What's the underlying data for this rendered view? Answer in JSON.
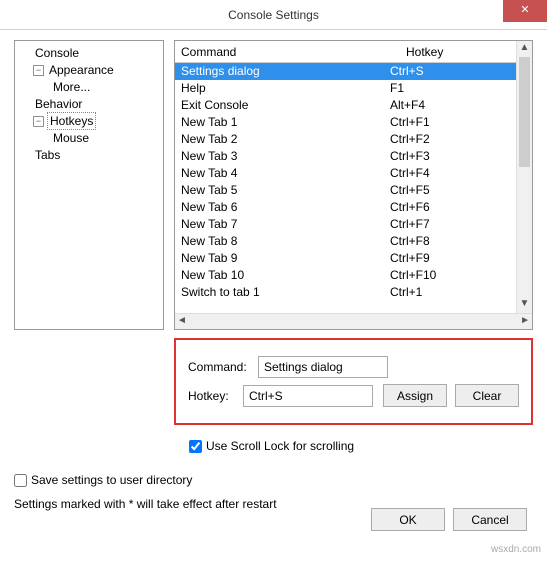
{
  "title": "Console Settings",
  "tree": {
    "items": [
      {
        "label": "Console",
        "level": 1
      },
      {
        "label": "Appearance",
        "level": 1,
        "expander": "-"
      },
      {
        "label": "More...",
        "level": 2
      },
      {
        "label": "Behavior",
        "level": 1
      },
      {
        "label": "Hotkeys",
        "level": 1,
        "expander": "-",
        "selected": true
      },
      {
        "label": "Mouse",
        "level": 2
      },
      {
        "label": "Tabs",
        "level": 1
      }
    ]
  },
  "list": {
    "header_command": "Command",
    "header_hotkey": "Hotkey",
    "rows": [
      {
        "cmd": "Settings dialog",
        "hk": "Ctrl+S",
        "selected": true
      },
      {
        "cmd": "Help",
        "hk": "F1"
      },
      {
        "cmd": "Exit Console",
        "hk": "Alt+F4"
      },
      {
        "cmd": "New Tab 1",
        "hk": "Ctrl+F1"
      },
      {
        "cmd": "New Tab 2",
        "hk": "Ctrl+F2"
      },
      {
        "cmd": "New Tab 3",
        "hk": "Ctrl+F3"
      },
      {
        "cmd": "New Tab 4",
        "hk": "Ctrl+F4"
      },
      {
        "cmd": "New Tab 5",
        "hk": "Ctrl+F5"
      },
      {
        "cmd": "New Tab 6",
        "hk": "Ctrl+F6"
      },
      {
        "cmd": "New Tab 7",
        "hk": "Ctrl+F7"
      },
      {
        "cmd": "New Tab 8",
        "hk": "Ctrl+F8"
      },
      {
        "cmd": "New Tab 9",
        "hk": "Ctrl+F9"
      },
      {
        "cmd": "New Tab 10",
        "hk": "Ctrl+F10"
      },
      {
        "cmd": "Switch to tab 1",
        "hk": "Ctrl+1"
      }
    ]
  },
  "form": {
    "command_label": "Command:",
    "command_value": "Settings dialog",
    "hotkey_label": "Hotkey:",
    "hotkey_value": "Ctrl+S",
    "assign": "Assign",
    "clear": "Clear"
  },
  "scroll_lock_label": "Use Scroll Lock for scrolling",
  "save_label": "Save settings to user directory",
  "restart_note": "Settings marked with * will take effect after restart",
  "ok": "OK",
  "cancel": "Cancel",
  "watermark": "wsxdn.com"
}
